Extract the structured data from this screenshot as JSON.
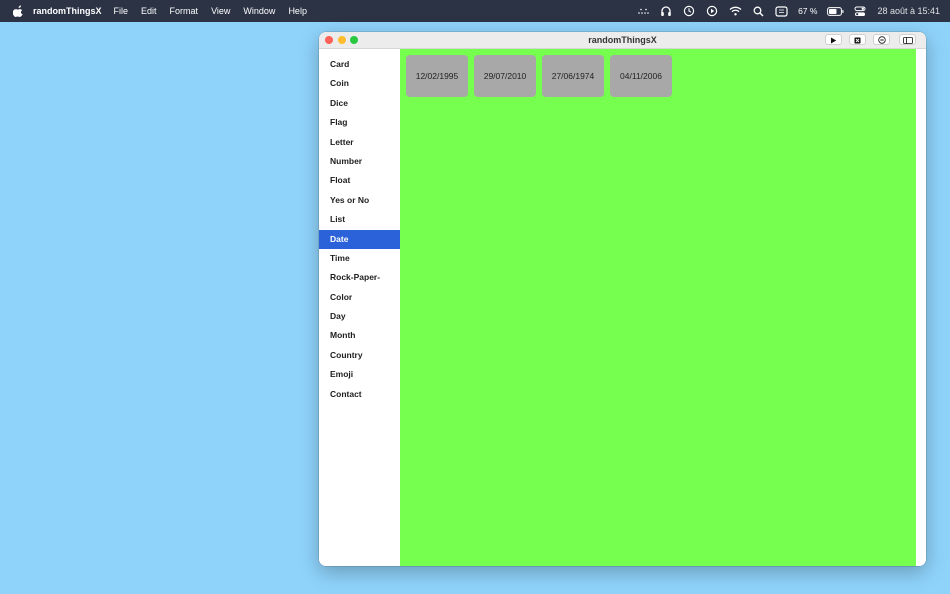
{
  "menubar": {
    "app_name": "randomThingsX",
    "items": [
      "File",
      "Edit",
      "Format",
      "View",
      "Window",
      "Help"
    ],
    "battery_percent": "67 %",
    "clock": "28 août à 15:41"
  },
  "window": {
    "title": "randomThingsX",
    "sidebar": {
      "items": [
        "Card",
        "Coin",
        "Dice",
        "Flag",
        "Letter",
        "Number",
        "Float",
        "Yes or No",
        "List",
        "Date",
        "Time",
        "Rock-Paper-",
        "Color",
        "Day",
        "Month",
        "Country",
        "Emoji",
        "Contact"
      ],
      "selected": "Date"
    },
    "dates": [
      "12/02/1995",
      "29/07/2010",
      "27/06/1974",
      "04/11/2006"
    ],
    "colors": {
      "content_bg": "#77ff4f",
      "selected_bg": "#2b62d9",
      "card_bg": "#a8a8a8",
      "desktop": "#8fd3fb"
    }
  },
  "icons": {
    "menubar": [
      "apple-icon",
      "keyboard-dots-icon",
      "headphones-icon",
      "clock-icon",
      "play-circle-icon",
      "wifi-icon",
      "search-icon",
      "display-icon",
      "battery-icon",
      "control-center-icon"
    ],
    "toolbar": [
      "play-icon",
      "stop-icon",
      "minus-circle-icon",
      "sidebar-toggle-icon"
    ]
  }
}
